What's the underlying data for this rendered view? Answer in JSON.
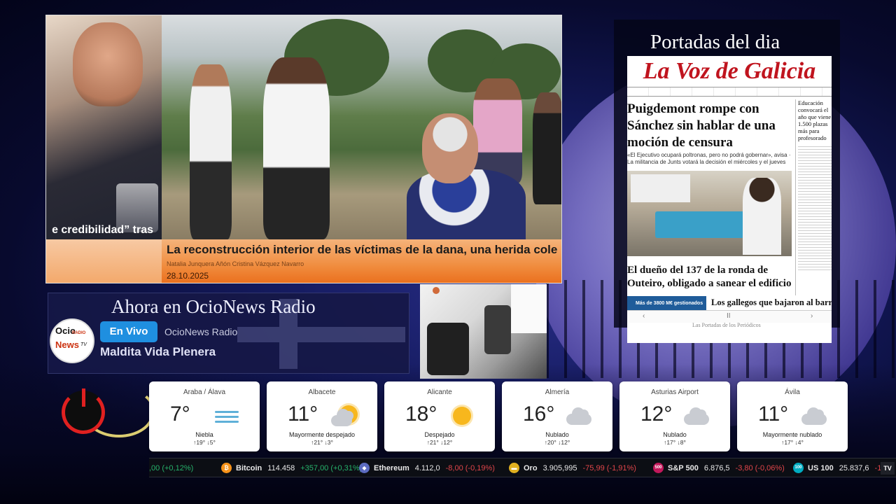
{
  "news": {
    "ticker_left": "e credibilidad” tras",
    "headline": "La reconstrucción interior de las víctimas de la dana, una herida cole",
    "credit": "Natalia Junquera Añón Cristina Vázquez Navarro",
    "date": "28.10.2025"
  },
  "radio": {
    "title": "Ahora en OcioNews Radio",
    "logo_line1": "Ocio",
    "logo_line2": "RADIO",
    "logo_line3": "News",
    "logo_line4": "TV",
    "live_label": "En Vivo",
    "station": "OcioNews Radio",
    "show": "Maldita Vida Plenera"
  },
  "portadas": {
    "title": "Portadas del dia",
    "masthead": "La Voz de Galicia",
    "headline": "Puigdemont rompe con Sánchez sin hablar de una moción de censura",
    "sub": "«El Ejecutivo ocupará poltronas, pero no podrá gobernar», avisa · La militancia de Junts votará la decisión el miércoles y el jueves",
    "sidebar_head": "Educación convocará el año que viene 1.500 plazas más para profesorado",
    "headline2": "El dueño del 137 de la ronda de Outeiro, obligado a sanear el edificio",
    "bluebar": "Más de 3800 M€ gestionados",
    "bottom_head": "Los gallegos que bajaron al barro",
    "nav_prev": "‹",
    "nav_mid": "II",
    "nav_next": "›",
    "footer": "Las Portadas de los Periódicos"
  },
  "weather": [
    {
      "place": "Araba / Álava",
      "temp": "7°",
      "icon": "fog-icon",
      "cond": "Niebla",
      "range": "↑19° ↓5°"
    },
    {
      "place": "Albacete",
      "temp": "11°",
      "icon": "sun-cloud-icon",
      "cond": "Mayormente despejado",
      "range": "↑21° ↓3°"
    },
    {
      "place": "Alicante",
      "temp": "18°",
      "icon": "sun-icon",
      "cond": "Despejado",
      "range": "↑21° ↓12°"
    },
    {
      "place": "Almería",
      "temp": "16°",
      "icon": "cloud-icon",
      "cond": "Nublado",
      "range": "↑20° ↓12°"
    },
    {
      "place": "Asturias Airport",
      "temp": "12°",
      "icon": "cloud-icon",
      "cond": "Nublado",
      "range": "↑17° ↓8°"
    },
    {
      "place": "Ávila",
      "temp": "11°",
      "icon": "cloud-icon",
      "cond": "Mayormente nublado",
      "range": "↑17° ↓4°"
    }
  ],
  "ticker": {
    "lead": ",00 (+0,12%)",
    "items": [
      {
        "name": "Bitcoin",
        "price": "114.458",
        "change": "+357,00 (+0,31%)",
        "dir": "up",
        "icon_color": "#f7931a",
        "icon_text": "₿"
      },
      {
        "name": "Ethereum",
        "price": "4.112,0",
        "change": "-8,00 (-0,19%)",
        "dir": "down",
        "icon_color": "#5c6bc0",
        "icon_text": "◆"
      },
      {
        "name": "Oro",
        "price": "3.905,995",
        "change": "-75,99 (-1,91%)",
        "dir": "down",
        "icon_color": "#e0b020",
        "icon_text": "▬"
      },
      {
        "name": "S&P 500",
        "price": "6.876,5",
        "change": "-3,80 (-0,06%)",
        "dir": "down",
        "icon_color": "#c2185b",
        "icon_text": "500"
      },
      {
        "name": "US 100",
        "price": "25.837,6",
        "change": "-1",
        "dir": "down",
        "icon_color": "#00acc1",
        "icon_text": "100"
      }
    ],
    "tv_label": "TV"
  },
  "colors": {
    "accent_live": "#1f8fe0",
    "up": "#26b36b",
    "down": "#e0454a",
    "masthead_red": "#c0141e"
  }
}
